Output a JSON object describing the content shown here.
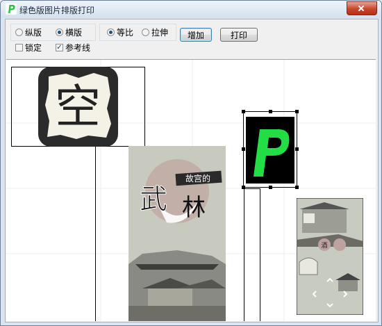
{
  "window": {
    "title": "绿色版图片排版打印"
  },
  "toolbar": {
    "orientation": {
      "portrait_label": "纵版",
      "landscape_label": "横版",
      "selected": "横版"
    },
    "scale": {
      "proportional_label": "等比",
      "stretch_label": "拉伸",
      "selected": "等比"
    },
    "lock_label": "锁定",
    "lock_checked": false,
    "guides_label": "参考线",
    "guides_checked": true,
    "add_label": "增加",
    "print_label": "打印"
  },
  "canvas": {
    "images": [
      {
        "kind": "app-icon-tile",
        "glyph": "空"
      },
      {
        "kind": "game-poster",
        "title_small": "故宫的",
        "title_big_1": "武",
        "title_big_2": "林"
      },
      {
        "kind": "logo-tile",
        "glyph": "P",
        "selected": true
      },
      {
        "kind": "game-screenshot",
        "jar_label": "酒"
      }
    ]
  },
  "colors": {
    "accent_green": "#22dd44",
    "window_title_bar": "#dbe5f1",
    "canvas_bg": "#ffffff"
  }
}
